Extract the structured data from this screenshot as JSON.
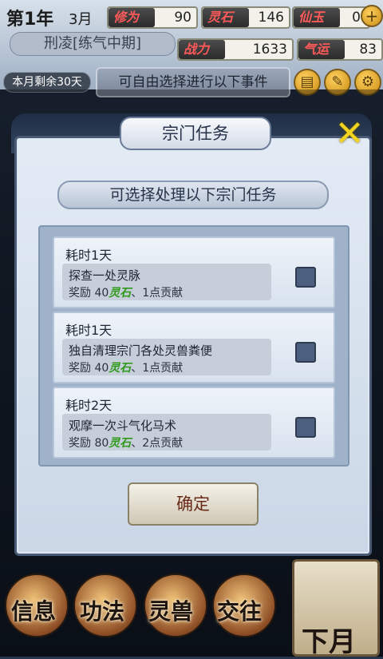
{
  "header": {
    "year": "第1年",
    "month": "3月",
    "name": "刑凌[练气中期]",
    "days_left": "本月剩余30天",
    "hint": "可自由选择进行以下事件"
  },
  "stats": {
    "cultivation": {
      "label": "修为",
      "value": "90"
    },
    "spirit_stone": {
      "label": "灵石",
      "value": "146"
    },
    "immortal_jade": {
      "label": "仙玉",
      "value": "0"
    },
    "combat_power": {
      "label": "战力",
      "value": "1633"
    },
    "luck": {
      "label": "气运",
      "value": "83"
    }
  },
  "dialog": {
    "title": "宗门任务",
    "subtitle": "可选择处理以下宗门任务",
    "confirm_label": "确定",
    "tasks": [
      {
        "duration": "耗时1天",
        "name": "探查一处灵脉",
        "reward_prefix": "奖励 40",
        "reward_item": "灵石",
        "reward_suffix": "、1点贡献"
      },
      {
        "duration": "耗时1天",
        "name": "独自清理宗门各处灵兽粪便",
        "reward_prefix": "奖励 40",
        "reward_item": "灵石",
        "reward_suffix": "、1点贡献"
      },
      {
        "duration": "耗时2天",
        "name": "观摩一次斗气化马术",
        "reward_prefix": "奖励 80",
        "reward_item": "灵石",
        "reward_suffix": "、2点贡献"
      }
    ]
  },
  "bottom_nav": {
    "info": "信息",
    "skills": "功法",
    "beasts": "灵兽",
    "social": "交往",
    "next_month": "下月"
  },
  "icons": [
    "add-icon",
    "close-icon",
    "scroll-icon",
    "brush-icon",
    "settings-icon"
  ],
  "colors": {
    "accent_gold": "#f2d320",
    "stat_label": "#ff5959",
    "reward_green": "#2f9a1a"
  }
}
